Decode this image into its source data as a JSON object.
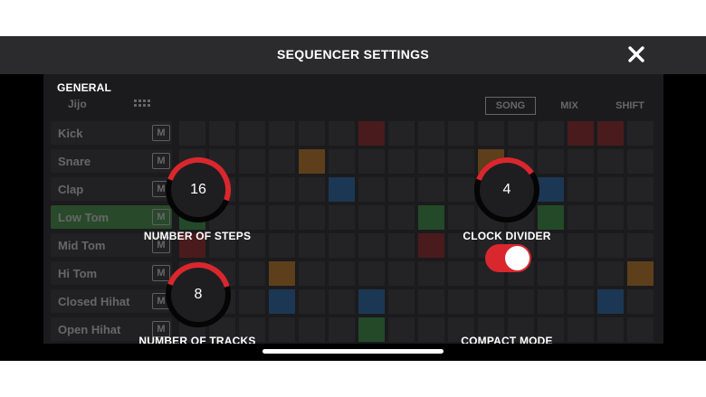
{
  "header": {
    "title": "SEQUENCER SETTINGS"
  },
  "section": {
    "title": "GENERAL"
  },
  "controls": {
    "steps": {
      "label": "NUMBER OF STEPS",
      "value": "16",
      "fraction": 0.5
    },
    "divider": {
      "label": "CLOCK DIVIDER",
      "value": "4",
      "fraction": 0.35
    },
    "tracks": {
      "label": "NUMBER OF TRACKS",
      "value": "8",
      "fraction": 0.4
    },
    "compact": {
      "label": "COMPACT MODE",
      "on": true
    }
  },
  "colors": {
    "accent": "#d9272e",
    "knob_track": "#000000",
    "toggle_on": "#d9272e",
    "pad_red": "#8b1c1c",
    "pad_orange": "#b8721a",
    "pad_blue": "#1f5f9e",
    "pad_green": "#2f8a3a",
    "track_active": "#3b8a3e"
  },
  "background": {
    "toolbar": {
      "logo": "Jijo",
      "grid_icon": "grid-icon",
      "box1": "SONG",
      "box2": "MIX",
      "box3": "SHIFT"
    },
    "tracks": [
      {
        "name": "Kick",
        "mute": "M",
        "active": false
      },
      {
        "name": "Snare",
        "mute": "M",
        "active": false
      },
      {
        "name": "Clap",
        "mute": "M",
        "active": false
      },
      {
        "name": "Low Tom",
        "mute": "M",
        "active": true
      },
      {
        "name": "Mid Tom",
        "mute": "M",
        "active": false
      },
      {
        "name": "Hi Tom",
        "mute": "M",
        "active": false
      },
      {
        "name": "Closed Hihat",
        "mute": "M",
        "active": false
      },
      {
        "name": "Open Hihat",
        "mute": "M",
        "active": false
      }
    ],
    "pads": [
      {
        "row": 0,
        "step": 6,
        "color": "pad_red"
      },
      {
        "row": 0,
        "step": 13,
        "color": "pad_red"
      },
      {
        "row": 0,
        "step": 14,
        "color": "pad_red"
      },
      {
        "row": 1,
        "step": 4,
        "color": "pad_orange"
      },
      {
        "row": 1,
        "step": 10,
        "color": "pad_orange"
      },
      {
        "row": 2,
        "step": 5,
        "color": "pad_blue"
      },
      {
        "row": 2,
        "step": 12,
        "color": "pad_blue"
      },
      {
        "row": 3,
        "step": 0,
        "color": "pad_green"
      },
      {
        "row": 3,
        "step": 8,
        "color": "pad_green"
      },
      {
        "row": 3,
        "step": 12,
        "color": "pad_green"
      },
      {
        "row": 4,
        "step": 8,
        "color": "pad_red"
      },
      {
        "row": 4,
        "step": 0,
        "color": "pad_red"
      },
      {
        "row": 5,
        "step": 3,
        "color": "pad_orange"
      },
      {
        "row": 5,
        "step": 15,
        "color": "pad_orange"
      },
      {
        "row": 6,
        "step": 3,
        "color": "pad_blue"
      },
      {
        "row": 6,
        "step": 6,
        "color": "pad_blue"
      },
      {
        "row": 6,
        "step": 14,
        "color": "pad_blue"
      },
      {
        "row": 7,
        "step": 6,
        "color": "pad_green"
      }
    ]
  }
}
